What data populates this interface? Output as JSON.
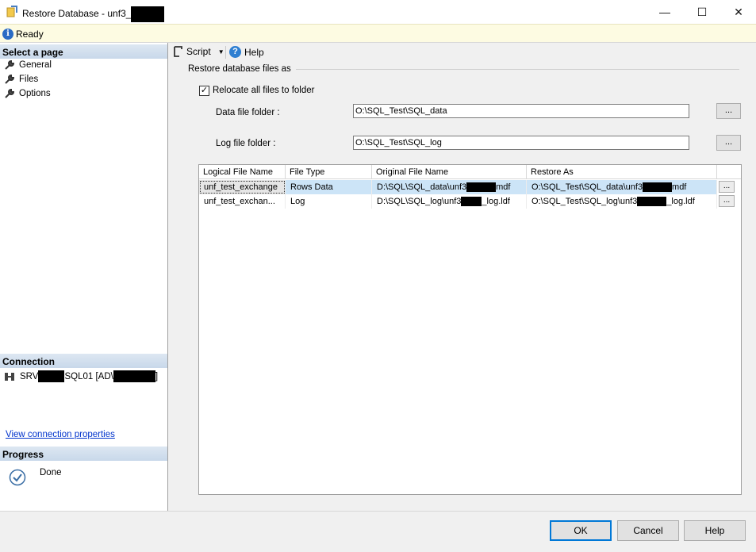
{
  "window": {
    "title": "Restore Database - unf3_",
    "min_glyph": "—",
    "max_glyph": "☐",
    "close_glyph": "✕"
  },
  "status": {
    "text": "Ready"
  },
  "left": {
    "select_page_header": "Select a page",
    "pages": [
      {
        "label": "General"
      },
      {
        "label": "Files"
      },
      {
        "label": "Options"
      }
    ],
    "connection_header": "Connection",
    "connection_prefix": "SRV",
    "connection_middle": "SQL01 [AD\\",
    "connection_suffix": "]",
    "view_connection_link": "View connection properties",
    "progress_header": "Progress",
    "progress_status": "Done"
  },
  "toolbar": {
    "script_label": "Script",
    "help_label": "Help"
  },
  "main": {
    "group_title": "Restore database files as",
    "relocate_label": "Relocate all files to folder",
    "relocate_checked": true,
    "data_folder_label": "Data file folder :",
    "data_folder_value": "O:\\SQL_Test\\SQL_data",
    "log_folder_label": "Log file folder :",
    "log_folder_value": "O:\\SQL_Test\\SQL_log",
    "browse_label": "..."
  },
  "grid": {
    "columns": [
      "Logical File Name",
      "File Type",
      "Original File Name",
      "Restore As"
    ],
    "rows": [
      {
        "logical": "unf_test_exchange",
        "type": "Rows Data",
        "orig_a": "D:\\SQL\\SQL_data\\unf3",
        "orig_b": "mdf",
        "restore_a": "O:\\SQL_Test\\SQL_data\\unf3",
        "restore_b": "mdf"
      },
      {
        "logical": "unf_test_exchan...",
        "type": "Log",
        "orig_a": "D:\\SQL\\SQL_log\\unf3",
        "orig_b": "_log.ldf",
        "restore_a": "O:\\SQL_Test\\SQL_log\\unf3",
        "restore_b": "_log.ldf"
      }
    ]
  },
  "buttons": {
    "ok": "OK",
    "cancel": "Cancel",
    "help": "Help"
  }
}
